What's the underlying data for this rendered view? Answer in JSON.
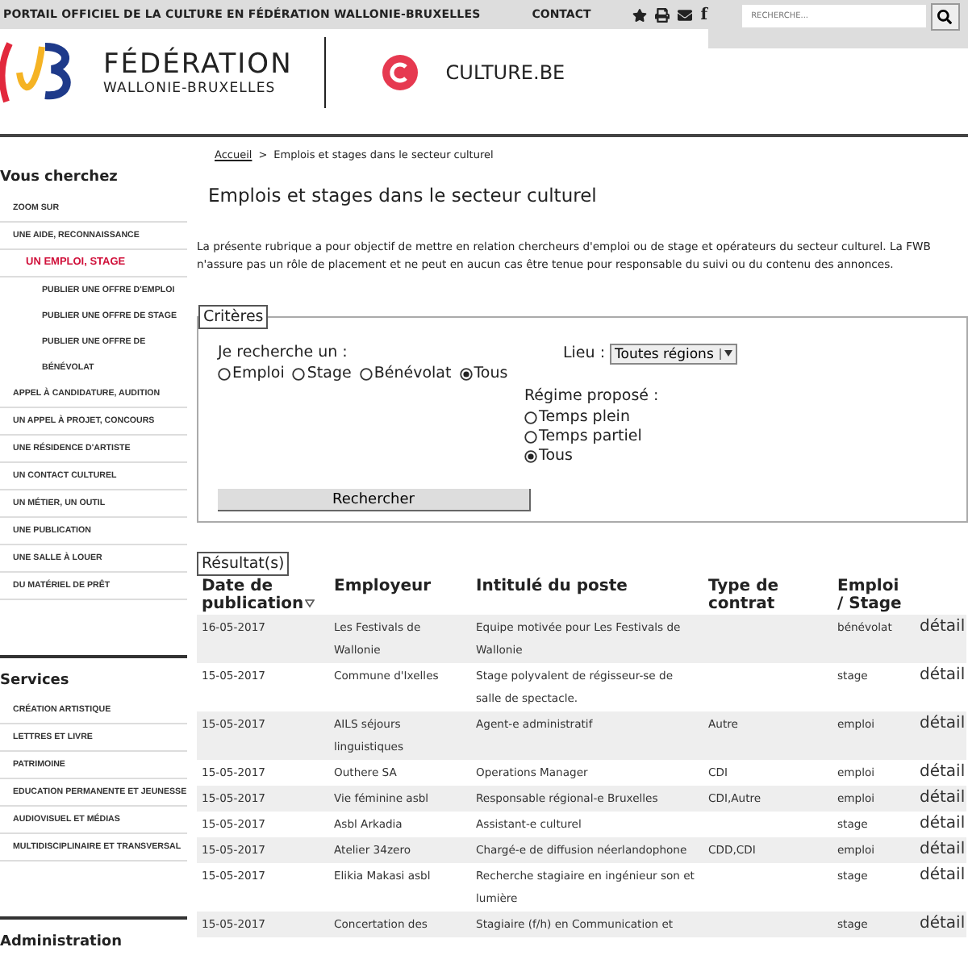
{
  "topbar": {
    "portal": "PORTAIL OFFICIEL DE LA CULTURE EN FÉDÉRATION WALLONIE-BRUXELLES",
    "contact": "CONTACT",
    "facebook": "f",
    "search": {
      "placeholder": "RECHERCHE..."
    }
  },
  "header": {
    "brand_line1": "FÉDÉRATION",
    "brand_line2": "WALLONIE-BRUXELLES",
    "site": "CULTURE.BE"
  },
  "sidebar": {
    "sections": [
      {
        "title": "Vous cherchez",
        "items": [
          {
            "label": "ZOOM SUR",
            "selected": false
          },
          {
            "label": "UNE AIDE, RECONNAISSANCE",
            "selected": false
          },
          {
            "label": "UN EMPLOI, STAGE",
            "selected": true,
            "children": [
              {
                "label": "PUBLIER UNE OFFRE D'EMPLOI"
              },
              {
                "label": "PUBLIER UNE OFFRE DE STAGE"
              },
              {
                "label": "PUBLIER UNE OFFRE DE BÉNÉVOLAT"
              }
            ]
          },
          {
            "label": "APPEL À CANDIDATURE, AUDITION",
            "selected": false
          },
          {
            "label": "UN APPEL À PROJET, CONCOURS",
            "selected": false
          },
          {
            "label": "UNE RÉSIDENCE D'ARTISTE",
            "selected": false
          },
          {
            "label": "UN CONTACT CULTUREL",
            "selected": false
          },
          {
            "label": "UN MÉTIER, UN OUTIL",
            "selected": false
          },
          {
            "label": "UNE PUBLICATION",
            "selected": false
          },
          {
            "label": "UNE SALLE À LOUER",
            "selected": false
          },
          {
            "label": "DU MATÉRIEL DE PRÊT",
            "selected": false
          }
        ]
      },
      {
        "title": "Services",
        "items": [
          {
            "label": "CRÉATION ARTISTIQUE",
            "selected": false
          },
          {
            "label": "LETTRES ET LIVRE",
            "selected": false
          },
          {
            "label": "PATRIMOINE",
            "selected": false
          },
          {
            "label": "EDUCATION PERMANENTE ET JEUNESSE",
            "selected": false
          },
          {
            "label": "AUDIOVISUEL ET MÉDIAS",
            "selected": false
          },
          {
            "label": "MULTIDISCIPLINAIRE ET TRANSVERSAL",
            "selected": false
          }
        ]
      },
      {
        "title": "Administration"
      }
    ]
  },
  "breadcrumb": {
    "home": "Accueil",
    "separator": ">",
    "current": "Emplois et stages dans le secteur culturel"
  },
  "title": "Emplois et stages dans le secteur culturel",
  "intro": "La présente rubrique a pour objectif de mettre en relation chercheurs d'emploi ou de stage et opérateurs du secteur culturel. La FWB n'assure pas un rôle de placement et ne peut en aucun cas être tenue pour responsable du suivi ou du contenu des annonces.",
  "criteria": {
    "legend": "Critères",
    "type_label": "Je recherche un :",
    "types": [
      {
        "label": "Emploi",
        "selected": false
      },
      {
        "label": "Stage",
        "selected": false
      },
      {
        "label": "Bénévolat",
        "selected": false
      },
      {
        "label": "Tous",
        "selected": true
      }
    ],
    "place_label": "Lieu :",
    "place_value": "Toutes régions",
    "regime_label": "Régime proposé :",
    "regimes": [
      {
        "label": "Temps plein",
        "selected": false
      },
      {
        "label": "Temps partiel",
        "selected": false
      },
      {
        "label": "Tous",
        "selected": true
      }
    ],
    "submit": "Rechercher"
  },
  "results": {
    "legend": "Résultat(s)",
    "columns": [
      "Date de publication",
      "Employeur",
      "Intitulé du poste",
      "Type de contrat",
      "Emploi / Stage"
    ],
    "rows": [
      {
        "date": "16-05-2017",
        "employer": "Les Festivals de Wallonie",
        "title": "Equipe motivée pour Les Festivals de Wallonie",
        "contract": "",
        "type": "bénévolat",
        "link": "détail"
      },
      {
        "date": "15-05-2017",
        "employer": "Commune d'Ixelles",
        "title": "Stage polyvalent de régisseur-se de salle de spectacle.",
        "contract": "",
        "type": "stage",
        "link": "détail"
      },
      {
        "date": "15-05-2017",
        "employer": "AILS séjours linguistiques",
        "title": "Agent-e administratif",
        "contract": "Autre",
        "type": "emploi",
        "link": "détail"
      },
      {
        "date": "15-05-2017",
        "employer": "Outhere SA",
        "title": "Operations Manager",
        "contract": "CDI",
        "type": "emploi",
        "link": "détail"
      },
      {
        "date": "15-05-2017",
        "employer": "Vie féminine asbl",
        "title": "Responsable régional-e Bruxelles",
        "contract": "CDI,Autre",
        "type": "emploi",
        "link": "détail"
      },
      {
        "date": "15-05-2017",
        "employer": "Asbl Arkadia",
        "title": "Assistant-e culturel",
        "contract": "",
        "type": "stage",
        "link": "détail"
      },
      {
        "date": "15-05-2017",
        "employer": "Atelier 34zero",
        "title": "Chargé-e de diffusion néerlandophone",
        "contract": "CDD,CDI",
        "type": "emploi",
        "link": "détail"
      },
      {
        "date": "15-05-2017",
        "employer": "Elikia Makasi asbl",
        "title": "Recherche stagiaire en ingénieur son et lumière",
        "contract": "",
        "type": "stage",
        "link": "détail"
      },
      {
        "date": "15-05-2017",
        "employer": "Concertation des",
        "title": "Stagiaire (f/h) en Communication et",
        "contract": "",
        "type": "stage",
        "link": "détail"
      }
    ]
  }
}
